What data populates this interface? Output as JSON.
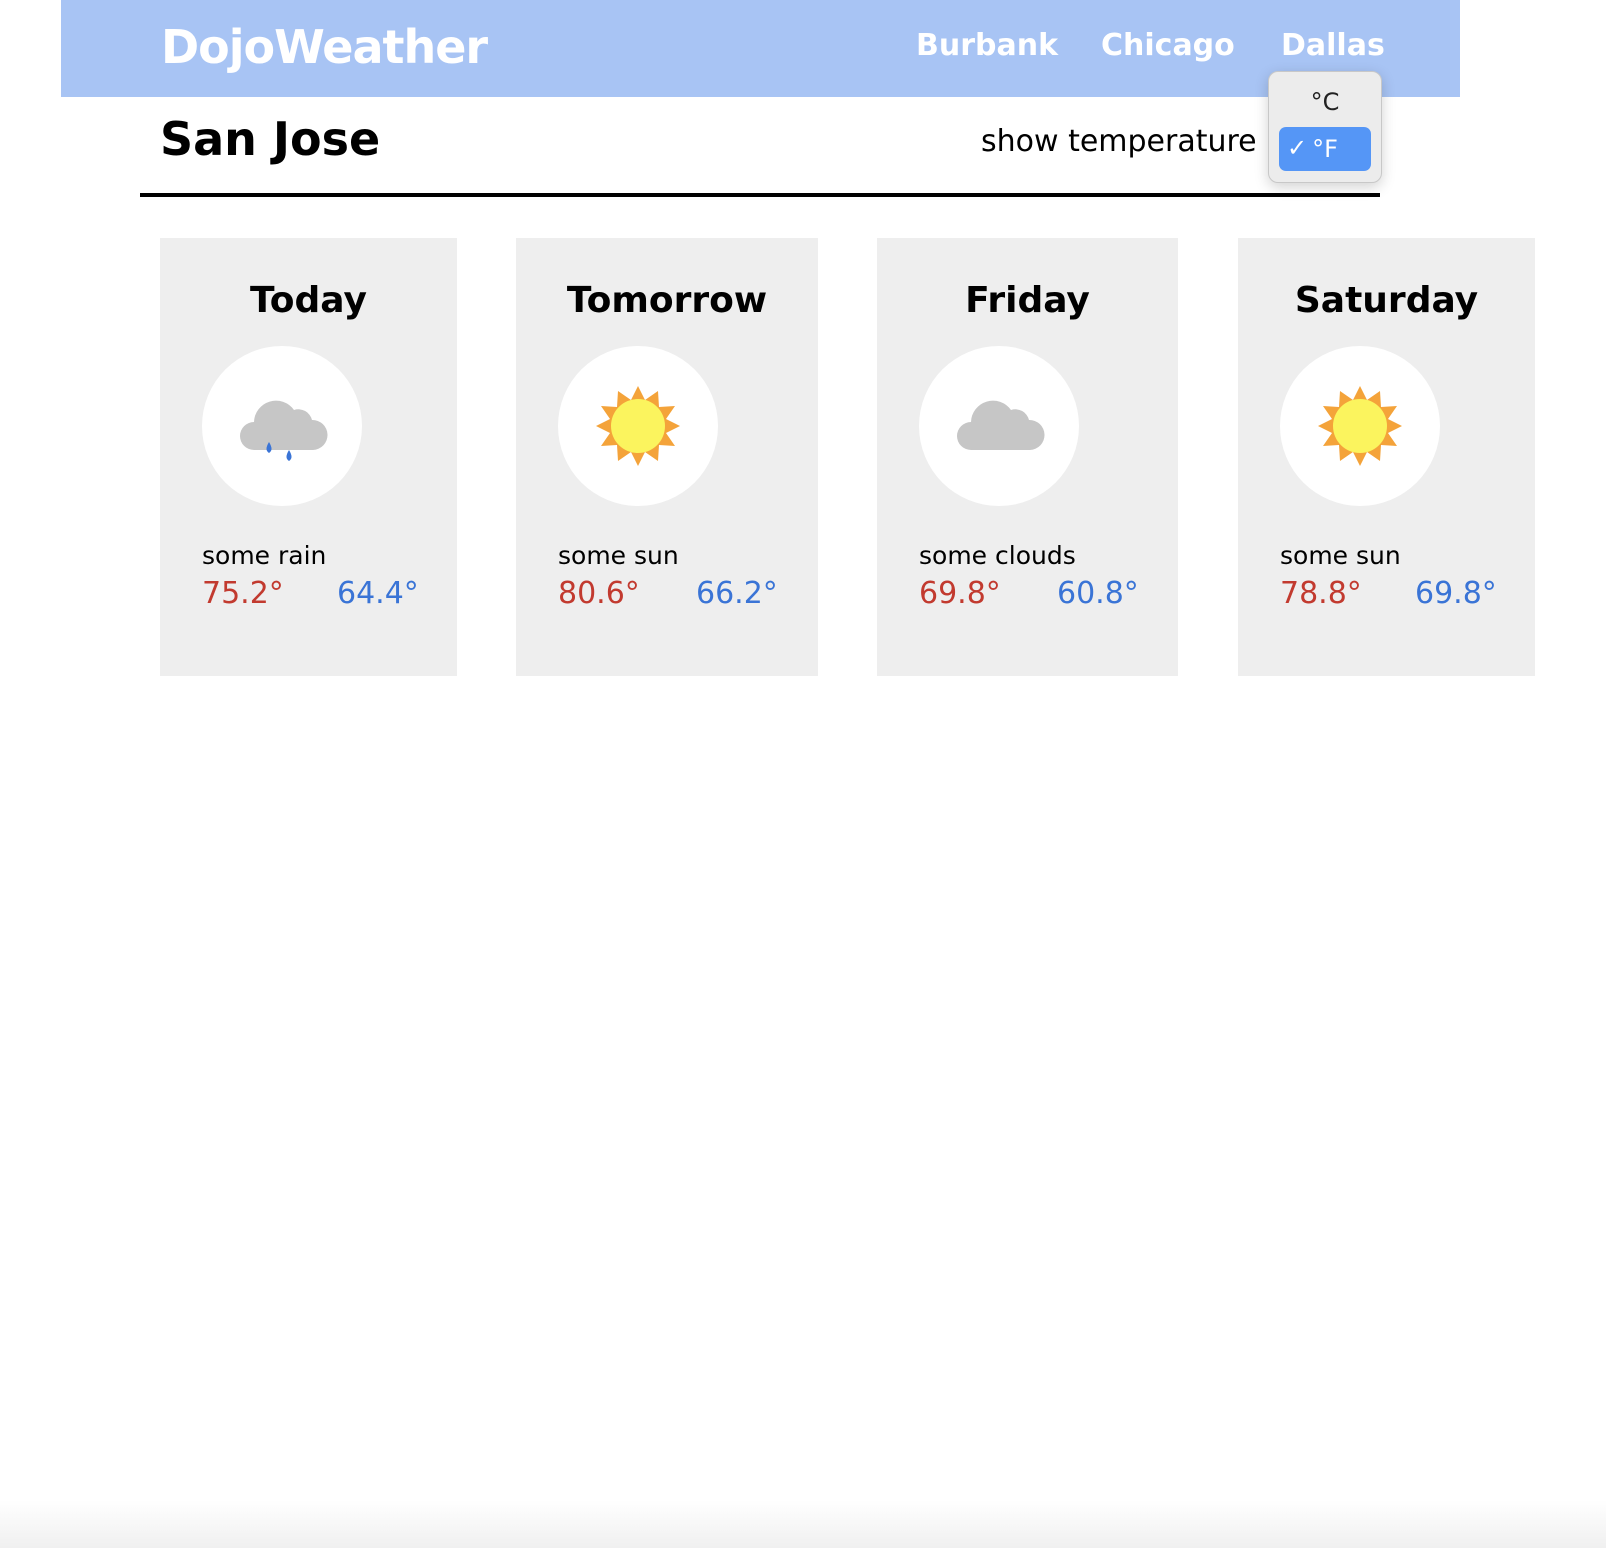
{
  "header": {
    "logo": "DojoWeather",
    "nav": [
      "Burbank",
      "Chicago",
      "Dallas"
    ],
    "background": "#a8c4f4"
  },
  "city": "San Jose",
  "unit_label": "show temperature in",
  "unit_dropdown": {
    "options": [
      "°C",
      "°F"
    ],
    "selected": "°F",
    "check": "✓"
  },
  "forecast": [
    {
      "day": "Today",
      "icon": "rain-cloud-icon",
      "desc": "some rain",
      "high": "75.2°",
      "low": "64.4°"
    },
    {
      "day": "Tomorrow",
      "icon": "sun-icon",
      "desc": "some sun",
      "high": "80.6°",
      "low": "66.2°"
    },
    {
      "day": "Friday",
      "icon": "cloud-icon",
      "desc": "some clouds",
      "high": "69.8°",
      "low": "60.8°"
    },
    {
      "day": "Saturday",
      "icon": "sun-icon",
      "desc": "some sun",
      "high": "78.8°",
      "low": "69.8°"
    }
  ],
  "colors": {
    "high": "#c23a2f",
    "low": "#3a74d6",
    "card": "#eeeeee",
    "selected_option": "#5596f6"
  }
}
